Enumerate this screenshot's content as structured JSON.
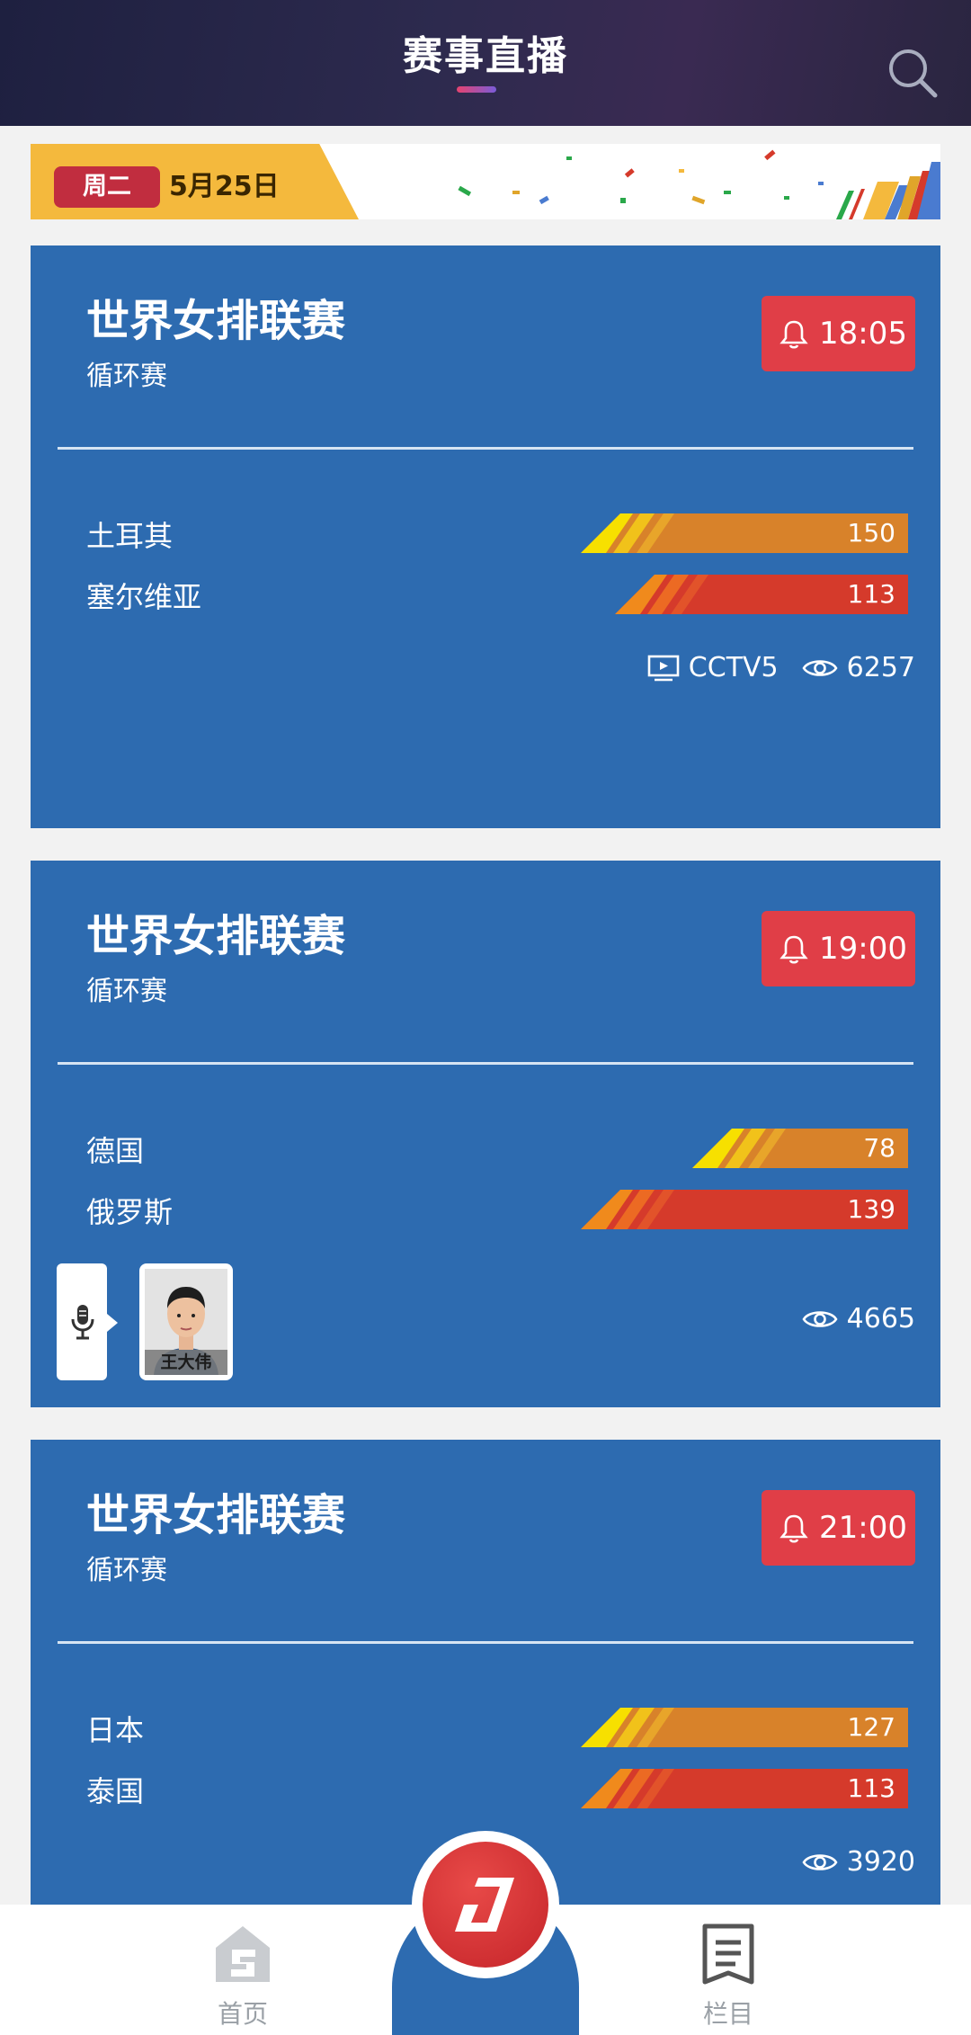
{
  "header": {
    "title": "赛事直播",
    "accent": "#e5436f"
  },
  "date_banner": {
    "weekday": "周二",
    "date": "5月25日"
  },
  "matches": [
    {
      "league": "世界女排联赛",
      "stage": "循环赛",
      "time": "18:05",
      "home": {
        "name": "土耳其",
        "value": "150"
      },
      "away": {
        "name": "塞尔维亚",
        "value": "113"
      },
      "channel": "CCTV5",
      "views": "6257"
    },
    {
      "league": "世界女排联赛",
      "stage": "循环赛",
      "time": "19:00",
      "home": {
        "name": "德国",
        "value": "78"
      },
      "away": {
        "name": "俄罗斯",
        "value": "139"
      },
      "commentator": "王大伟",
      "views": "4665"
    },
    {
      "league": "世界女排联赛",
      "stage": "循环赛",
      "time": "21:00",
      "home": {
        "name": "日本",
        "value": "127"
      },
      "away": {
        "name": "泰国",
        "value": "113"
      },
      "views": "3920"
    }
  ],
  "nav": {
    "home": "首页",
    "columns": "栏目"
  },
  "colors": {
    "card": "#2d6bb0",
    "badge": "#e03e47",
    "home_bar": "#d8822a",
    "away_bar": "#d53a2b",
    "date_tag": "#f4b93d"
  }
}
